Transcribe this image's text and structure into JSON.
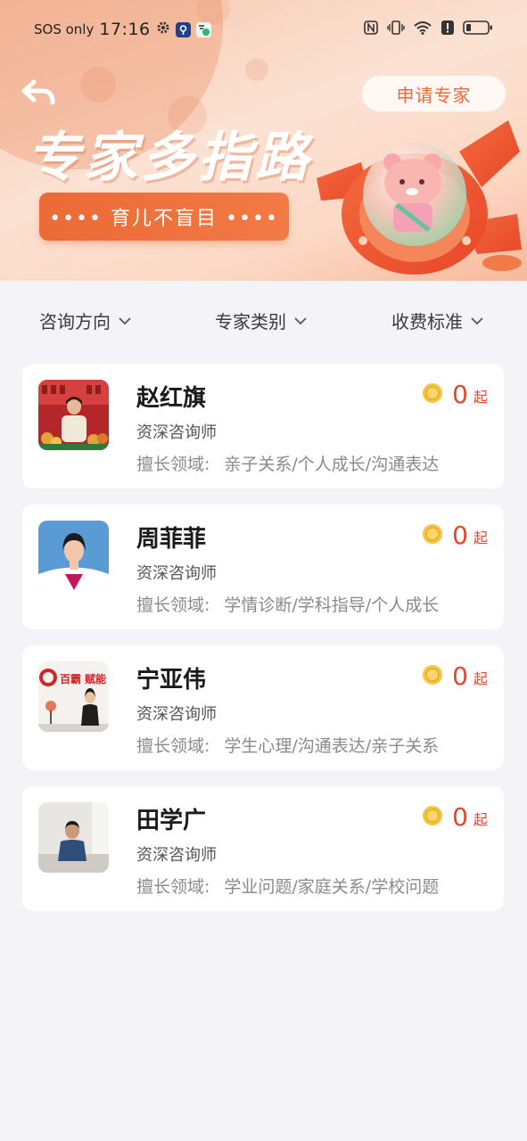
{
  "status_bar": {
    "carrier": "SOS only",
    "time": "17:16"
  },
  "banner": {
    "headline": "专家多指路",
    "subtitle": "•••• 育儿不盲目 ••••",
    "apply_button": "申请专家"
  },
  "filters": [
    {
      "label": "咨询方向"
    },
    {
      "label": "专家类别"
    },
    {
      "label": "收费标准"
    }
  ],
  "experts": [
    {
      "name": "赵红旗",
      "title": "资深咨询师",
      "specialty_label": "擅长领域:",
      "specialty": "亲子关系/个人成长/沟通表达",
      "price": "0",
      "price_unit": "起"
    },
    {
      "name": "周菲菲",
      "title": "资深咨询师",
      "specialty_label": "擅长领域:",
      "specialty": "学情诊断/学科指导/个人成长",
      "price": "0",
      "price_unit": "起"
    },
    {
      "name": "宁亚伟",
      "title": "资深咨询师",
      "specialty_label": "擅长领域:",
      "specialty": "学生心理/沟通表达/亲子关系",
      "price": "0",
      "price_unit": "起",
      "avatar_sign_text": "百霸 赋能"
    },
    {
      "name": "田学广",
      "title": "资深咨询师",
      "specialty_label": "擅长领域:",
      "specialty": "学业问题/家庭关系/学校问题",
      "price": "0",
      "price_unit": "起"
    }
  ],
  "colors": {
    "accent": "#ec6a3a",
    "price": "#e6452e",
    "background": "#f3f3f8",
    "card": "#ffffff"
  }
}
